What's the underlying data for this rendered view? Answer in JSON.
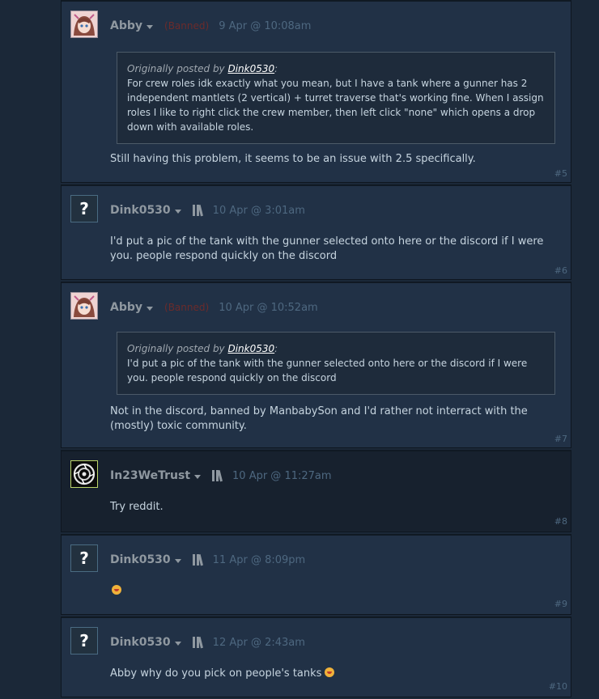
{
  "posts": [
    {
      "author": "Abby",
      "badge": "(Banned)",
      "time": "9 Apr @ 10:08am",
      "quote": {
        "attribution_prefix": "Originally posted by ",
        "attribution_name": "Dink0530",
        "attribution_suffix": ":",
        "text": "For crew roles idk exactly what you mean, but I have a tank where a gunner has 2 independent mantlets (2 vertical) + turret traverse that's working fine. When I assign roles I like to right click the crew member, then left click \"none\" which opens a drop down with available roles."
      },
      "text": "Still having this problem, it seems to be an issue with 2.5 specifically.",
      "number": "#5"
    },
    {
      "author": "Dink0530",
      "time": "10 Apr @ 3:01am",
      "text": "I'd put a pic of the tank with the gunner selected onto here or the discord if I were you. people respond quickly on the discord",
      "number": "#6"
    },
    {
      "author": "Abby",
      "badge": "(Banned)",
      "time": "10 Apr @ 10:52am",
      "quote": {
        "attribution_prefix": "Originally posted by ",
        "attribution_name": "Dink0530",
        "attribution_suffix": ":",
        "text": "I'd put a pic of the tank with the gunner selected onto here or the discord if I were you. people respond quickly on the discord"
      },
      "text": "Not in the discord, banned by ManbabySon and I'd rather not interract with the (mostly) toxic community.",
      "number": "#7"
    },
    {
      "author": "In23WeTrust",
      "time": "10 Apr @ 11:27am",
      "text": "Try reddit.",
      "number": "#8"
    },
    {
      "author": "Dink0530",
      "time": "11 Apr @ 8:09pm",
      "text": "",
      "number": "#9"
    },
    {
      "author": "Dink0530",
      "time": "12 Apr @ 2:43am",
      "text": "Abby why do you pick on people's tanks",
      "number": "#10"
    }
  ],
  "icons": {
    "unknown_avatar_glyph": "?",
    "caret": "chevron-down-icon",
    "library": "library-icon",
    "emoticon": "sad-face-emoticon"
  },
  "colors": {
    "page_bg": "#1b2838",
    "post_bg": "#213146",
    "author": "#8f98a0",
    "timestamp": "#4e6880",
    "banned": "#6b2b2b",
    "body_text": "#c6d4df"
  }
}
